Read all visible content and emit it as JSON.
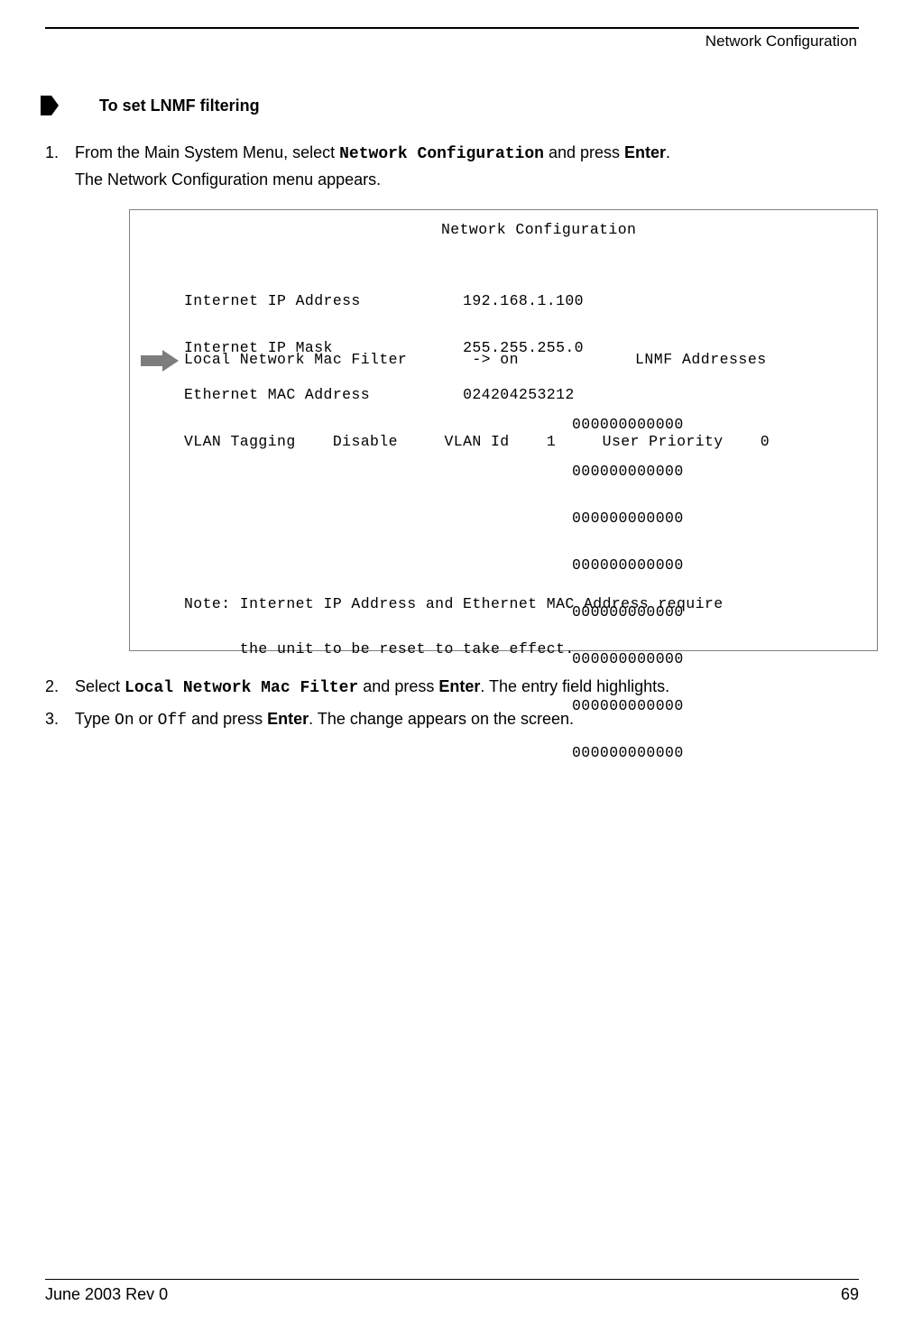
{
  "header": {
    "section_label": "Network Configuration"
  },
  "procedure": {
    "title": "To set LNMF filtering"
  },
  "steps": {
    "s1": {
      "pre": "From the Main System Menu, select ",
      "code": "Network Configuration",
      "mid": " and press ",
      "enter": "Enter",
      "post": ".",
      "sub": " The Network Configuration menu appears."
    },
    "s2": {
      "pre": "Select ",
      "code": "Local Network Mac Filter",
      "mid": " and press ",
      "enter": "Enter",
      "post": ". The entry field highlights."
    },
    "s3": {
      "pre": "Type ",
      "on": "On",
      "or": " or ",
      "off": "Off",
      "mid": " and press ",
      "enter": "Enter",
      "post": ". The change appears on the screen."
    }
  },
  "screen": {
    "title": "Network Configuration",
    "fields": {
      "ip_label": "Internet IP Address",
      "ip_value": "192.168.1.100",
      "mask_label": "Internet IP Mask",
      "mask_value": "255.255.255.0",
      "mac_label": "Ethernet MAC Address",
      "mac_value": "024204253212",
      "vlan_row_label": "VLAN Tagging",
      "vlan_status": "Disable",
      "vlan_id_label": "VLAN Id",
      "vlan_id_value": "1",
      "prio_label": "User Priority",
      "prio_value": "0"
    },
    "lnmf": {
      "label": "Local Network Mac Filter",
      "arrow": "->",
      "value": "on",
      "addr_header": "LNMF Addresses",
      "addresses": [
        "000000000000",
        "000000000000",
        "000000000000",
        "000000000000",
        "000000000000",
        "000000000000",
        "000000000000",
        "000000000000"
      ]
    },
    "note_line1": "Note: Internet IP Address and Ethernet MAC Address require",
    "note_line2": "      the unit to be reset to take effect."
  },
  "footer": {
    "date": "June 2003 Rev 0",
    "page": "69"
  }
}
